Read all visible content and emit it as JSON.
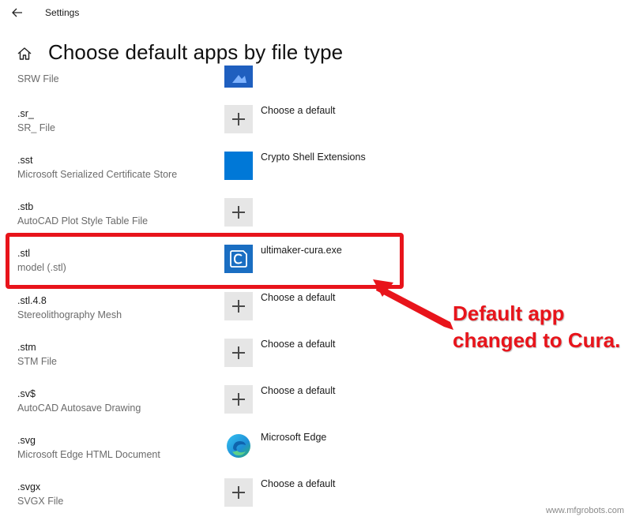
{
  "window": {
    "title": "Settings"
  },
  "page": {
    "title": "Choose default apps by file type"
  },
  "partial_row": {
    "description": "SRW File"
  },
  "rows": [
    {
      "extension": ".sr_",
      "description": "SR_ File",
      "app": "Choose a default",
      "tile": "plus"
    },
    {
      "extension": ".sst",
      "description": "Microsoft Serialized Certificate Store",
      "app": "Crypto Shell Extensions",
      "tile": "crypto"
    },
    {
      "extension": ".stb",
      "description": "AutoCAD Plot Style Table File",
      "app": "",
      "tile": "plus"
    },
    {
      "extension": ".stl",
      "description": "model (.stl)",
      "app": "ultimaker-cura.exe",
      "tile": "cura"
    },
    {
      "extension": ".stl.4.8",
      "description": "Stereolithography Mesh",
      "app": "Choose a default",
      "tile": "plus"
    },
    {
      "extension": ".stm",
      "description": "STM File",
      "app": "Choose a default",
      "tile": "plus"
    },
    {
      "extension": ".sv$",
      "description": "AutoCAD Autosave Drawing",
      "app": "Choose a default",
      "tile": "plus"
    },
    {
      "extension": ".svg",
      "description": "Microsoft Edge HTML Document",
      "app": "Microsoft Edge",
      "tile": "edge"
    },
    {
      "extension": ".svgx",
      "description": "SVGX File",
      "app": "Choose a default",
      "tile": "plus"
    }
  ],
  "annotation": {
    "line1": "Default app",
    "line2": "changed to Cura."
  },
  "watermark": "www.mfgrobots.com",
  "colors": {
    "accent": "#0078d7",
    "annotation_red": "#e8141b",
    "tile_gray": "#e6e6e6"
  },
  "icons": {
    "back": "arrow-left-icon",
    "home": "home-icon"
  }
}
